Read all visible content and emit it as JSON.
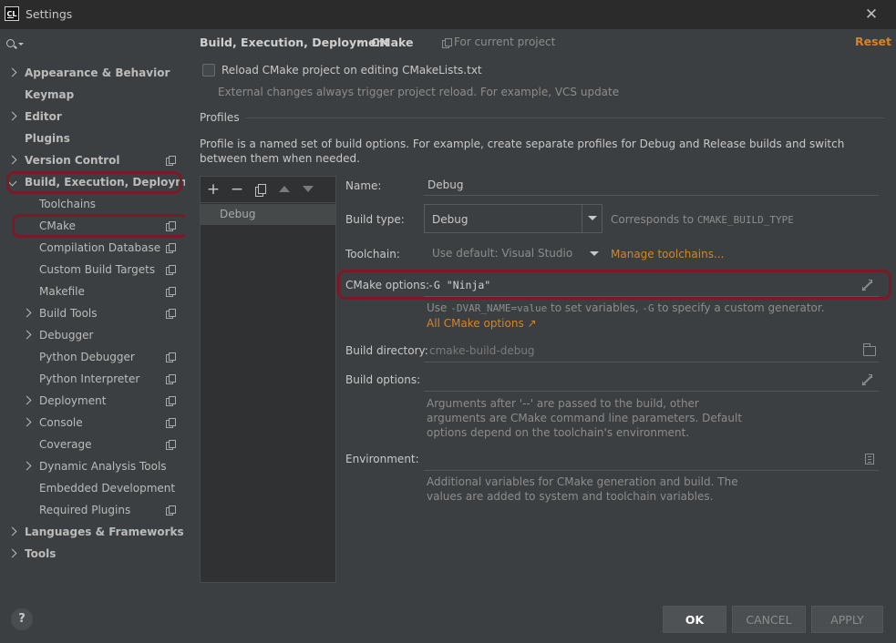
{
  "window": {
    "app_icon_text": "CL",
    "title": "Settings",
    "close_label": "✕"
  },
  "sidebar": {
    "items": [
      {
        "label": "Appearance & Behavior",
        "level": 0,
        "chevron": "right",
        "project_scoped": false
      },
      {
        "label": "Keymap",
        "level": 0,
        "chevron": "none",
        "project_scoped": false
      },
      {
        "label": "Editor",
        "level": 0,
        "chevron": "right",
        "project_scoped": false
      },
      {
        "label": "Plugins",
        "level": 0,
        "chevron": "none",
        "project_scoped": false
      },
      {
        "label": "Version Control",
        "level": 0,
        "chevron": "right",
        "project_scoped": true
      },
      {
        "label": "Build, Execution, Deployment",
        "level": 0,
        "chevron": "down",
        "project_scoped": false
      },
      {
        "label": "Toolchains",
        "level": 1,
        "chevron": "none",
        "project_scoped": false
      },
      {
        "label": "CMake",
        "level": 1,
        "chevron": "none",
        "project_scoped": true
      },
      {
        "label": "Compilation Database",
        "level": 1,
        "chevron": "none",
        "project_scoped": true
      },
      {
        "label": "Custom Build Targets",
        "level": 1,
        "chevron": "none",
        "project_scoped": true
      },
      {
        "label": "Makefile",
        "level": 1,
        "chevron": "none",
        "project_scoped": true
      },
      {
        "label": "Build Tools",
        "level": 1,
        "chevron": "right",
        "project_scoped": true
      },
      {
        "label": "Debugger",
        "level": 1,
        "chevron": "right",
        "project_scoped": false
      },
      {
        "label": "Python Debugger",
        "level": 1,
        "chevron": "none",
        "project_scoped": true
      },
      {
        "label": "Python Interpreter",
        "level": 1,
        "chevron": "none",
        "project_scoped": true
      },
      {
        "label": "Deployment",
        "level": 1,
        "chevron": "right",
        "project_scoped": true
      },
      {
        "label": "Console",
        "level": 1,
        "chevron": "right",
        "project_scoped": true
      },
      {
        "label": "Coverage",
        "level": 1,
        "chevron": "none",
        "project_scoped": true
      },
      {
        "label": "Dynamic Analysis Tools",
        "level": 1,
        "chevron": "right",
        "project_scoped": false
      },
      {
        "label": "Embedded Development",
        "level": 1,
        "chevron": "none",
        "project_scoped": false
      },
      {
        "label": "Required Plugins",
        "level": 1,
        "chevron": "none",
        "project_scoped": true
      },
      {
        "label": "Languages & Frameworks",
        "level": 0,
        "chevron": "right",
        "project_scoped": false
      },
      {
        "label": "Tools",
        "level": 0,
        "chevron": "right",
        "project_scoped": false
      }
    ]
  },
  "header": {
    "breadcrumb_parent": "Build, Execution, Deployment",
    "breadcrumb_sep": "›",
    "breadcrumb_current": "CMake",
    "scope": "For current project",
    "reset": "Reset"
  },
  "reload": {
    "checked": false,
    "label": "Reload CMake project on editing CMakeLists.txt",
    "hint": "External changes always trigger project reload. For example, VCS update"
  },
  "profiles": {
    "section_title": "Profiles",
    "description": "Profile is a named set of build options. For example, create separate profiles for Debug and Release builds and switch between them when needed.",
    "toolbar": {
      "add": "+",
      "remove": "−"
    },
    "list": [
      "Debug"
    ]
  },
  "form": {
    "name_label": "Name:",
    "name_value": "Debug",
    "build_type_label": "Build type:",
    "build_type_value": "Debug",
    "build_type_hint_prefix": "Corresponds to ",
    "build_type_hint_code": "CMAKE_BUILD_TYPE",
    "toolchain_label": "Toolchain:",
    "toolchain_value": "Use default: Visual Studio",
    "manage_toolchains": "Manage toolchains...",
    "cmake_options_label": "CMake options:",
    "cmake_options_value": "-G \"Ninja\"",
    "cmake_hint_1": "Use ",
    "cmake_hint_code1": "-DVAR_NAME=value",
    "cmake_hint_2": " to set variables, ",
    "cmake_hint_code2": "-G",
    "cmake_hint_3": " to specify a custom generator.",
    "all_cmake_options": "All CMake options ↗",
    "build_dir_label": "Build directory:",
    "build_dir_placeholder": "cmake-build-debug",
    "build_options_label": "Build options:",
    "build_options_value": "",
    "build_options_hint": "Arguments after '--' are passed to the build, other arguments are CMake command line parameters. Default options depend on the toolchain's environment.",
    "environment_label": "Environment:",
    "environment_value": "",
    "environment_hint": "Additional variables for CMake generation and build. The values are added to system and toolchain variables."
  },
  "footer": {
    "help": "?",
    "ok": "OK",
    "cancel": "CANCEL",
    "apply": "APPLY"
  },
  "colors": {
    "accent_orange": "#d5832a",
    "highlight_ring": "#7a1a28",
    "background": "#3c3f41"
  }
}
